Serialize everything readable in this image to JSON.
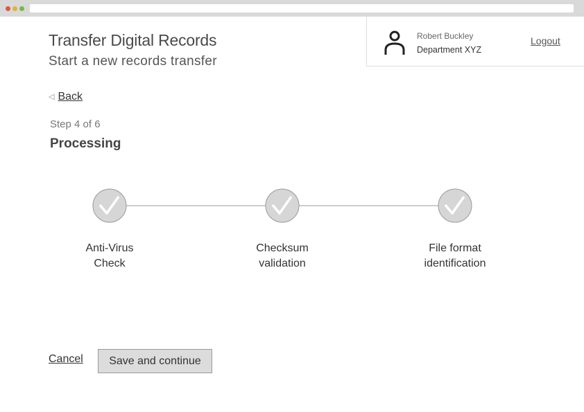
{
  "header": {
    "title": "Transfer Digital Records",
    "subtitle": "Start a new records transfer"
  },
  "user": {
    "name": "Robert Buckley",
    "department": "Department XYZ",
    "logout_label": "Logout",
    "icon": "user-icon"
  },
  "nav": {
    "back_label": "Back"
  },
  "step": {
    "label": "Step 4 of 6",
    "title": "Processing"
  },
  "progress": {
    "steps": [
      {
        "line1": "Anti-Virus",
        "line2": "Check",
        "status": "complete"
      },
      {
        "line1": "Checksum",
        "line2": "validation",
        "status": "complete"
      },
      {
        "line1": "File format",
        "line2": "identification",
        "status": "complete"
      }
    ]
  },
  "actions": {
    "cancel_label": "Cancel",
    "save_label": "Save and continue"
  }
}
